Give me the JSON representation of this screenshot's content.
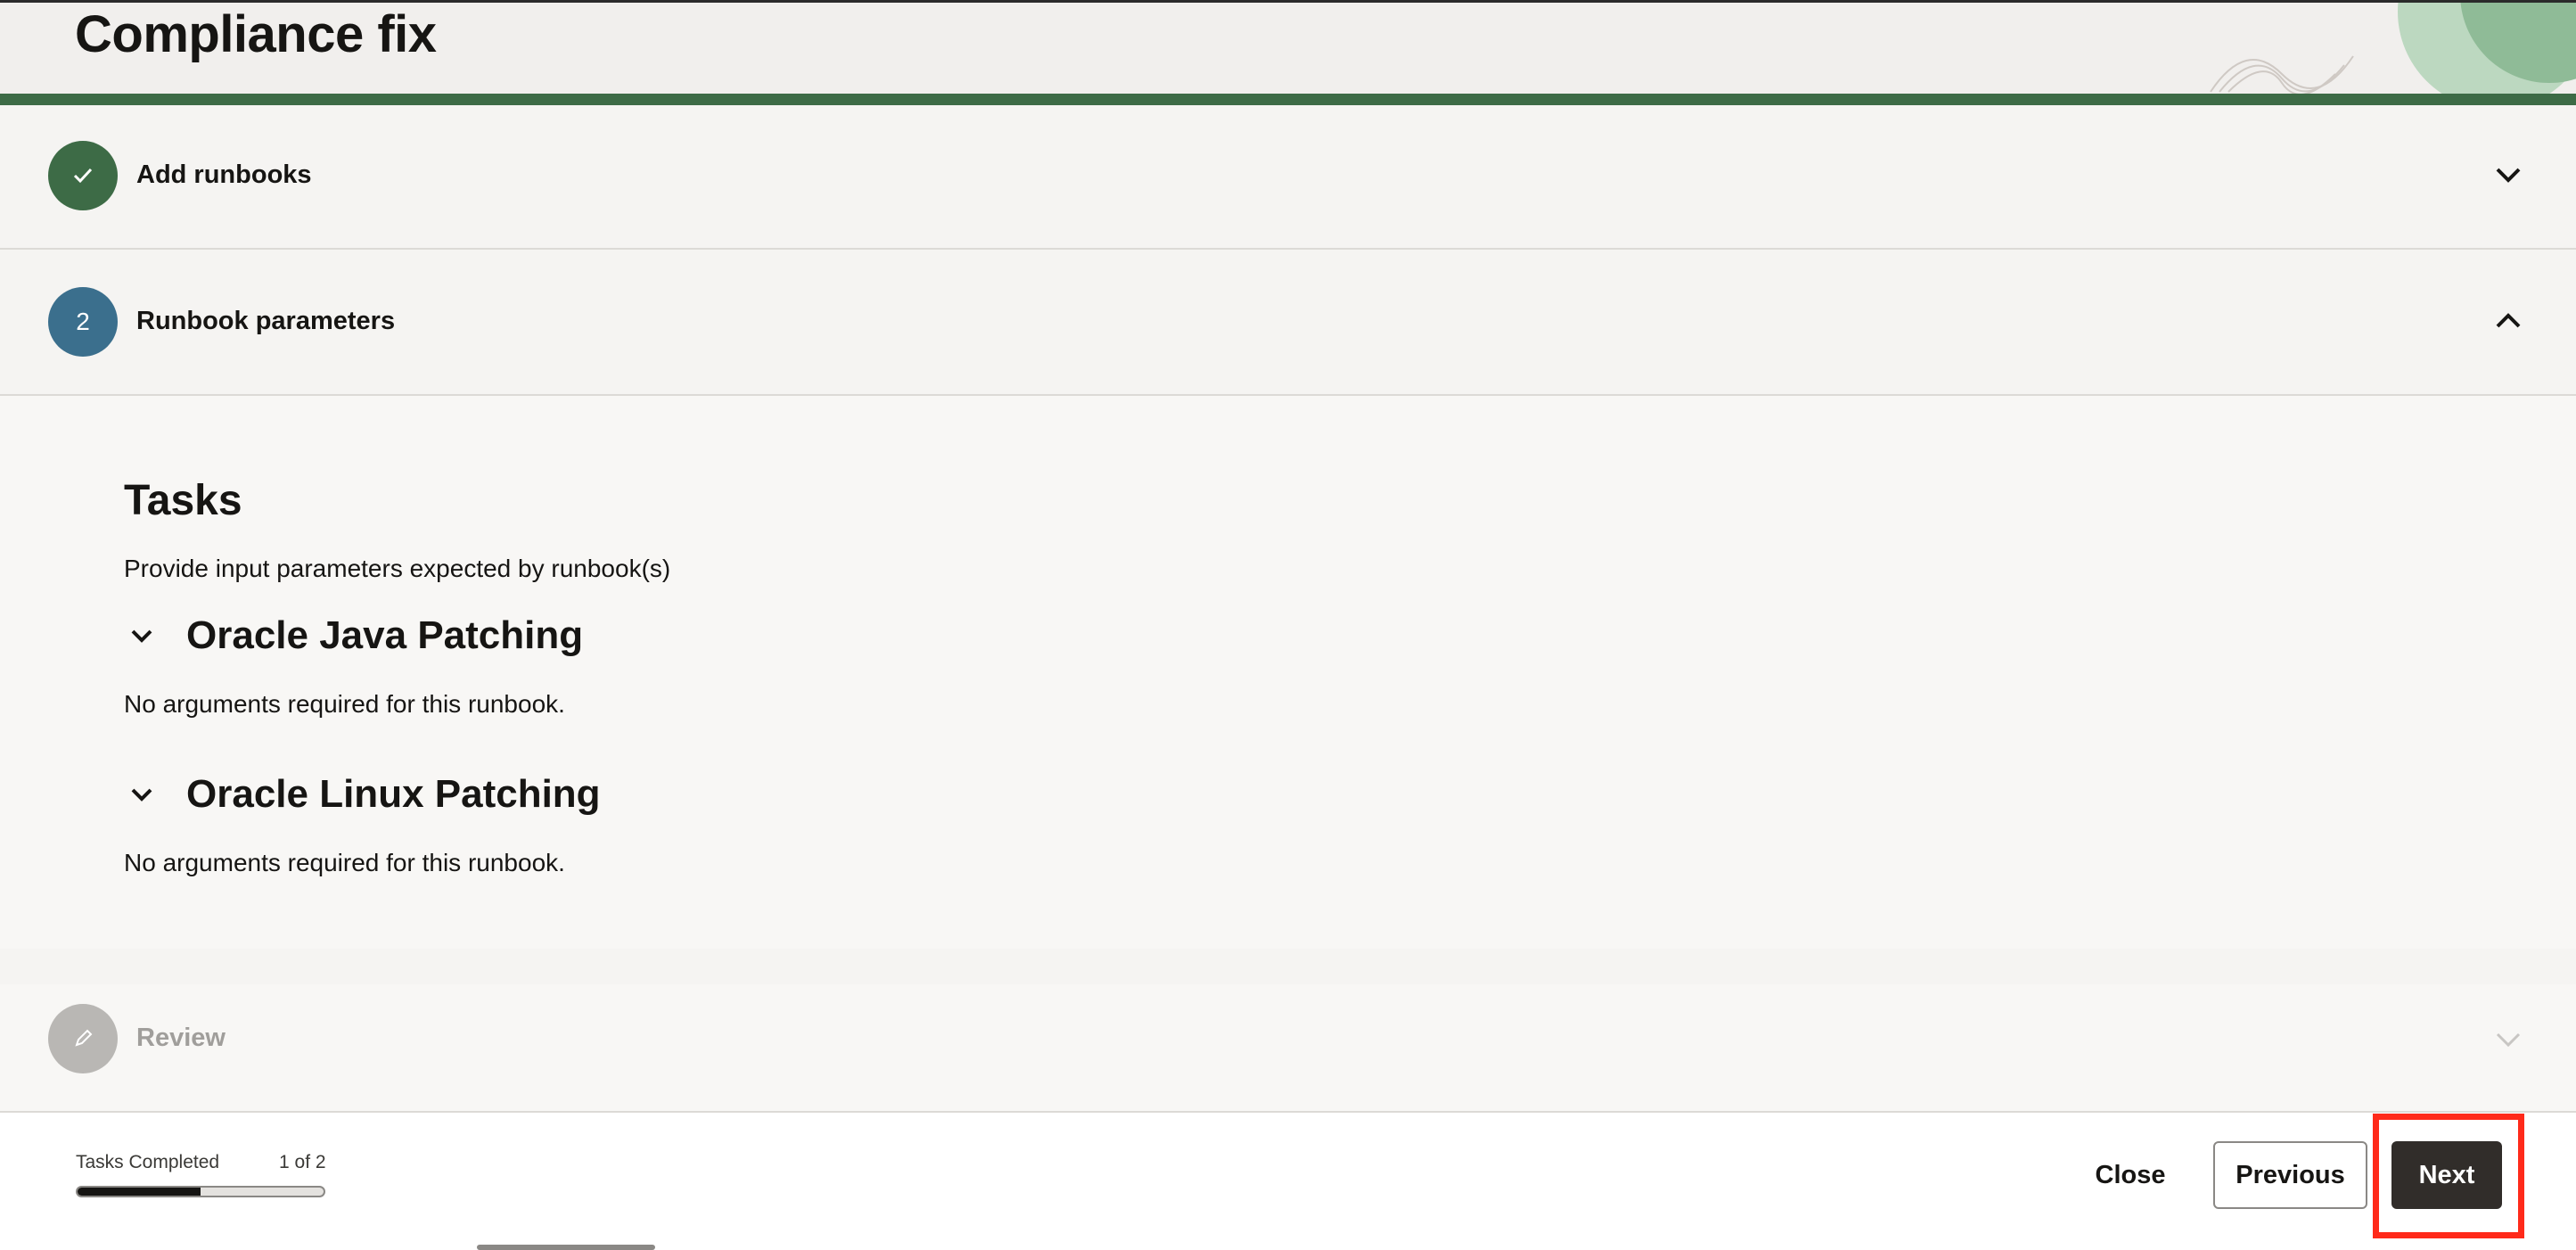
{
  "header": {
    "title": "Compliance fix"
  },
  "steps": [
    {
      "number": "",
      "icon": "check-icon",
      "label": "Add runbooks",
      "state": "completed",
      "color": "#3d6b46"
    },
    {
      "number": "2",
      "icon": "",
      "label": "Runbook parameters",
      "state": "active",
      "color": "#3b6f8d"
    },
    {
      "number": "",
      "icon": "pencil-icon",
      "label": "Review",
      "state": "disabled",
      "color": "#b9b7b4"
    }
  ],
  "tasks": {
    "title": "Tasks",
    "description": "Provide input parameters expected by runbook(s)",
    "runbooks": [
      {
        "title": "Oracle Java Patching",
        "note": "No arguments required for this runbook."
      },
      {
        "title": "Oracle Linux Patching",
        "note": "No arguments required for this runbook."
      }
    ]
  },
  "footer": {
    "progress_label": "Tasks Completed",
    "progress_count": "1 of 2",
    "progress_fraction": 0.5,
    "close_label": "Close",
    "previous_label": "Previous",
    "next_label": "Next"
  }
}
